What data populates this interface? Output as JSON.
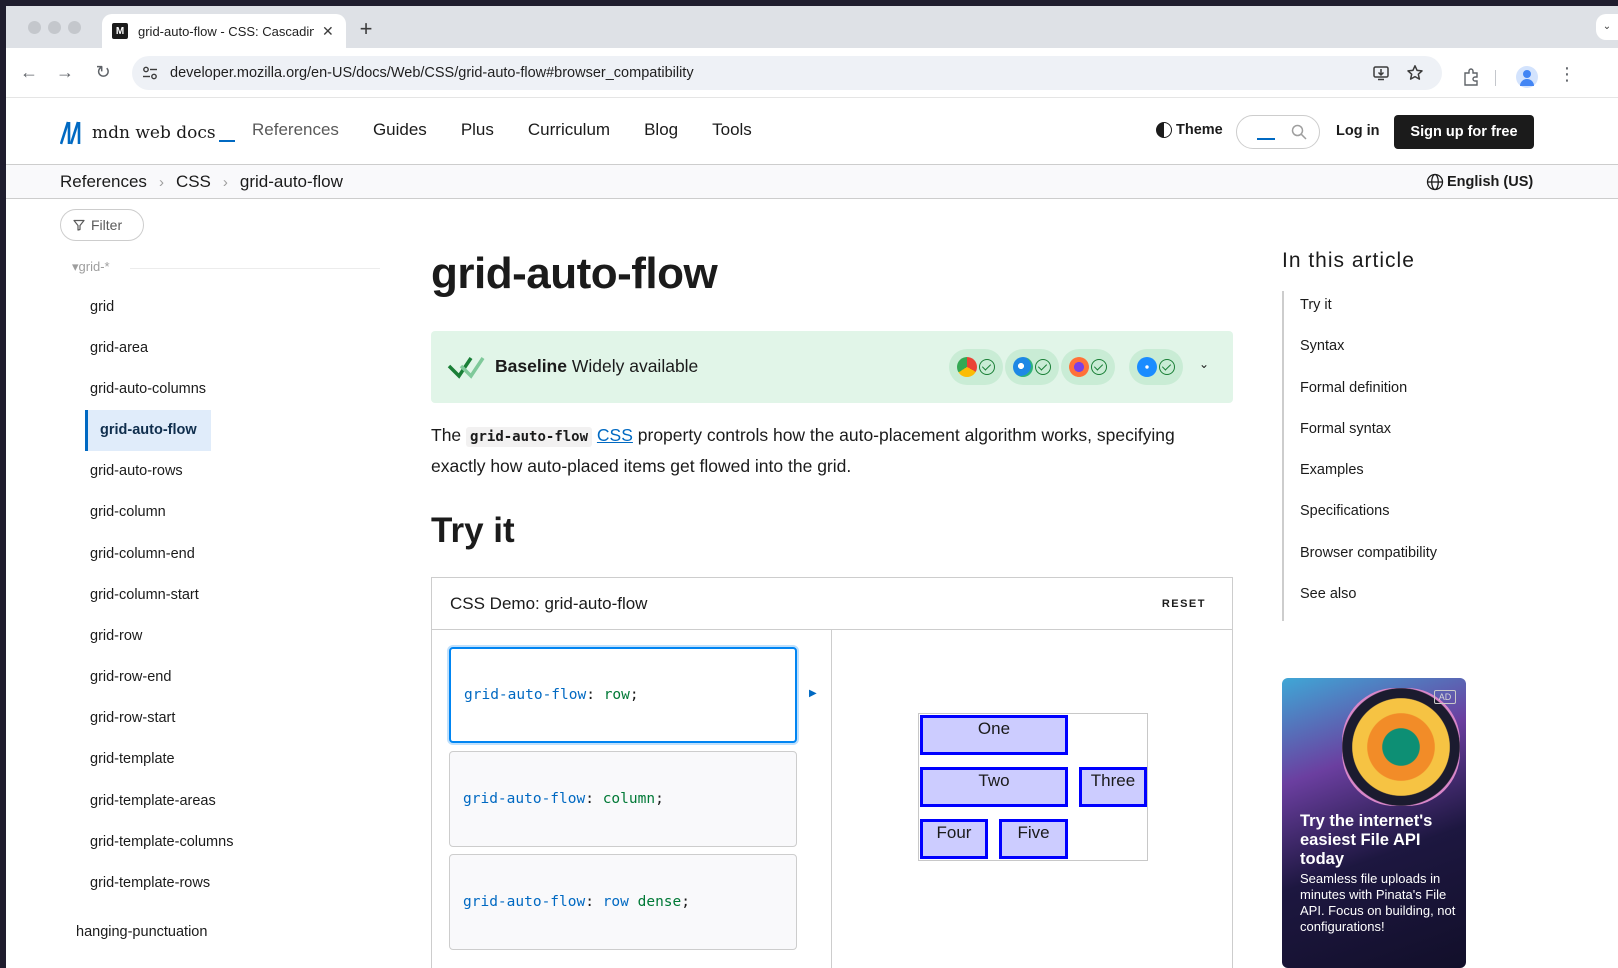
{
  "browser": {
    "tab_title": "grid-auto-flow - CSS: Cascading Style Sheets | MDN",
    "favicon_text": "M",
    "new_tab_label": "+",
    "url": "developer.mozilla.org/en-US/docs/Web/CSS/grid-auto-flow#browser_compatibility"
  },
  "header": {
    "logo_text": "mdn web docs",
    "nav": [
      "References",
      "Guides",
      "Plus",
      "Curriculum",
      "Blog",
      "Tools"
    ],
    "theme_label": "Theme",
    "login_label": "Log in",
    "signup_label": "Sign up for free"
  },
  "breadcrumb": {
    "items": [
      "References",
      "CSS",
      "grid-auto-flow"
    ],
    "language": "English (US)"
  },
  "sidebar": {
    "filter_label": "Filter",
    "group_label": "▾grid-*",
    "items": [
      "grid",
      "grid-area",
      "grid-auto-columns",
      "grid-auto-flow",
      "grid-auto-rows",
      "grid-column",
      "grid-column-end",
      "grid-column-start",
      "grid-row",
      "grid-row-end",
      "grid-row-start",
      "grid-template",
      "grid-template-areas",
      "grid-template-columns",
      "grid-template-rows"
    ],
    "next_item": "hanging-punctuation"
  },
  "main": {
    "title": "grid-auto-flow",
    "baseline_strong": "Baseline",
    "baseline_text": " Widely available",
    "intro_before": "The ",
    "intro_code": "grid-auto-flow",
    "intro_link": "CSS",
    "intro_after": " property controls how the auto-placement algorithm works, specifying exactly how auto-placed items get flowed into the grid.",
    "try_it_heading": "Try it",
    "demo_title": "CSS Demo: grid-auto-flow",
    "reset_label": "RESET",
    "code_options": [
      {
        "prop": "grid-auto-flow",
        "sep": ": ",
        "value": "row",
        "end": ";"
      },
      {
        "prop": "grid-auto-flow",
        "sep": ": ",
        "value": "column",
        "end": ";"
      },
      {
        "prop": "grid-auto-flow",
        "sep": ": ",
        "value1": "row",
        "value2": " dense",
        "end": ";"
      }
    ],
    "grid_items": [
      "One",
      "Two",
      "Three",
      "Four",
      "Five"
    ]
  },
  "toc": {
    "title": "In this article",
    "items": [
      "Try it",
      "Syntax",
      "Formal definition",
      "Formal syntax",
      "Examples",
      "Specifications",
      "Browser compatibility",
      "See also"
    ]
  },
  "ad": {
    "tag": "AD",
    "headline": "Try the internet's easiest File API today",
    "body": "Seamless file uploads in minutes with Pinata's File API. Focus on building, not configurations!"
  },
  "colors": {
    "mdn_blue": "#0069c2",
    "baseline_bg": "#e1f5e8",
    "grid_item_bg": "#ccccff",
    "grid_item_border": "#0000ff"
  }
}
